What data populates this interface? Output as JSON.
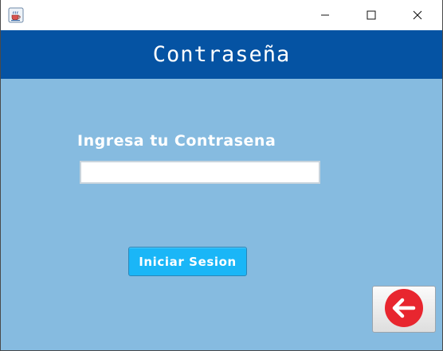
{
  "window": {
    "app_icon": "java-coffee-cup-icon",
    "controls": {
      "minimize_icon": "minimize-icon",
      "maximize_icon": "maximize-icon",
      "close_icon": "close-icon"
    }
  },
  "header": {
    "title": "Contraseña",
    "background_color": "#0553a3"
  },
  "form": {
    "prompt_label": "Ingresa tu Contrasena",
    "password_value": "",
    "login_button_label": "Iniciar Sesion",
    "back_button_icon": "arrow-left-circle-icon"
  },
  "colors": {
    "content_background": "#86bbe0",
    "login_button": "#1ab6f7",
    "back_icon_red": "#e8262f"
  }
}
